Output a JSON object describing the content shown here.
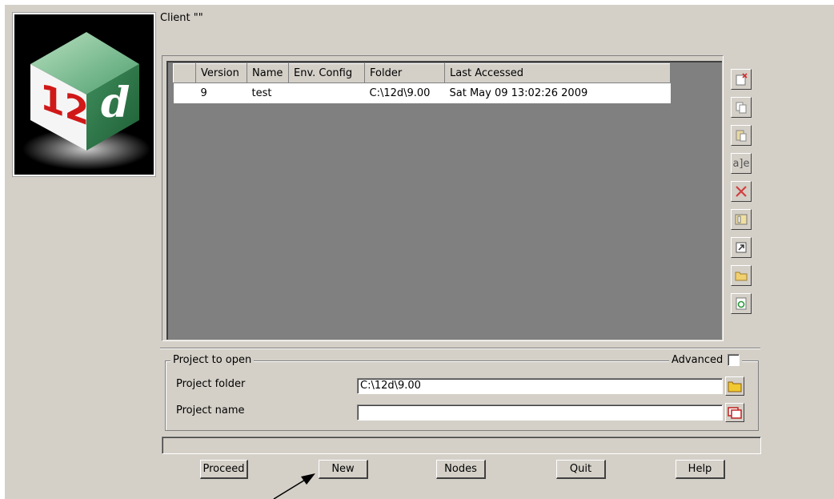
{
  "header": {
    "client_label": "Client \"\""
  },
  "logo": {
    "number_text": "12",
    "letter_text": "d"
  },
  "project_list": {
    "columns": [
      "Version",
      "Name",
      "Env. Config",
      "Folder",
      "Last Accessed"
    ],
    "rows": [
      {
        "version": "9",
        "name": "test",
        "env_config": "",
        "folder": "C:\\12d\\9.00",
        "last_accessed": "Sat May 09 13:02:26 2009"
      }
    ]
  },
  "toolbar_icons": [
    "clear-icon",
    "copy-icon",
    "paste-icon",
    "rename-icon",
    "delete-icon",
    "info-icon",
    "shortcut-icon",
    "open-folder-icon",
    "refresh-icon"
  ],
  "project_group": {
    "title": "Project to open",
    "advanced_label": "Advanced",
    "advanced_checked": false,
    "folder_label": "Project folder",
    "folder_value": "C:\\12d\\9.00",
    "name_label": "Project name",
    "name_value": ""
  },
  "buttons": {
    "proceed": "Proceed",
    "new": "New",
    "nodes": "Nodes",
    "quit": "Quit",
    "help": "Help"
  },
  "colors": {
    "dialog_bg": "#d4d0c8",
    "list_bg": "#808080",
    "logo_green": "#4e9f6e"
  }
}
